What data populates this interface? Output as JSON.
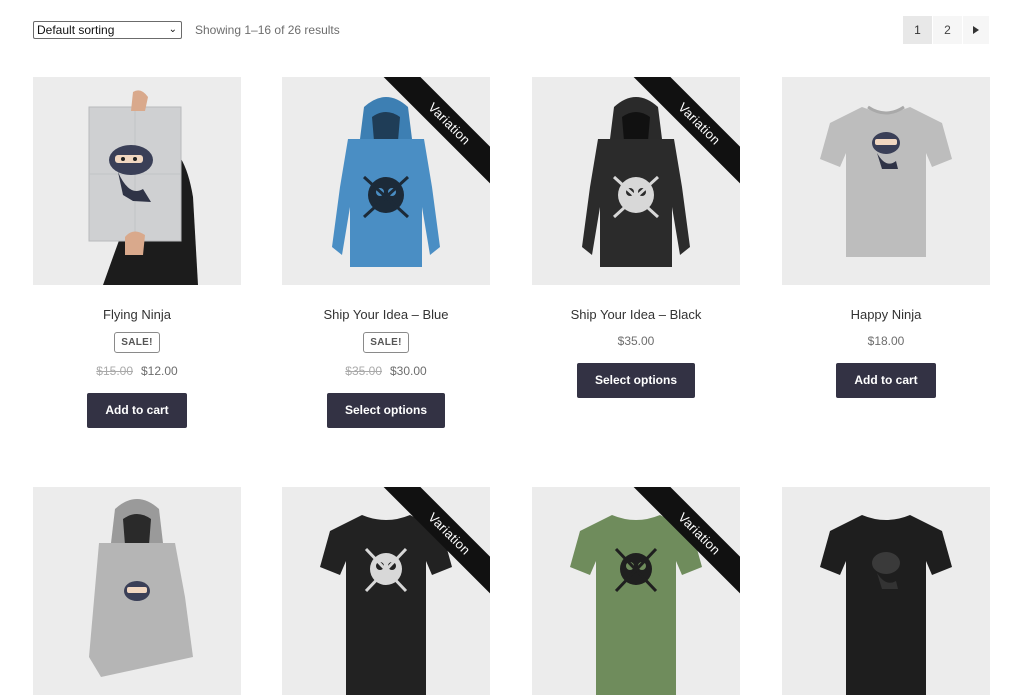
{
  "toolbar": {
    "sort_value": "Default sorting",
    "result_count": "Showing 1–16 of 26 results",
    "pages": [
      "1",
      "2"
    ],
    "current_page": "1",
    "next_icon": "caret-right-icon"
  },
  "colors": {
    "button_bg": "#333244",
    "thumb_bg": "#ececec",
    "ribbon_bg": "#111111"
  },
  "products": [
    {
      "title": "Flying Ninja",
      "badge": "SALE!",
      "old_price": "$15.00",
      "price": "$12.00",
      "button": "Add to cart",
      "ribbon": ""
    },
    {
      "title": "Ship Your Idea – Blue",
      "badge": "SALE!",
      "old_price": "$35.00",
      "price": "$30.00",
      "button": "Select options",
      "ribbon": "Variation"
    },
    {
      "title": "Ship Your Idea – Black",
      "badge": "",
      "old_price": "",
      "price": "$35.00",
      "button": "Select options",
      "ribbon": "Variation"
    },
    {
      "title": "Happy Ninja",
      "badge": "",
      "old_price": "",
      "price": "$18.00",
      "button": "Add to cart",
      "ribbon": ""
    },
    {
      "title": "",
      "ribbon": ""
    },
    {
      "title": "",
      "ribbon": "Variation"
    },
    {
      "title": "",
      "ribbon": "Variation"
    },
    {
      "title": "",
      "ribbon": ""
    }
  ]
}
